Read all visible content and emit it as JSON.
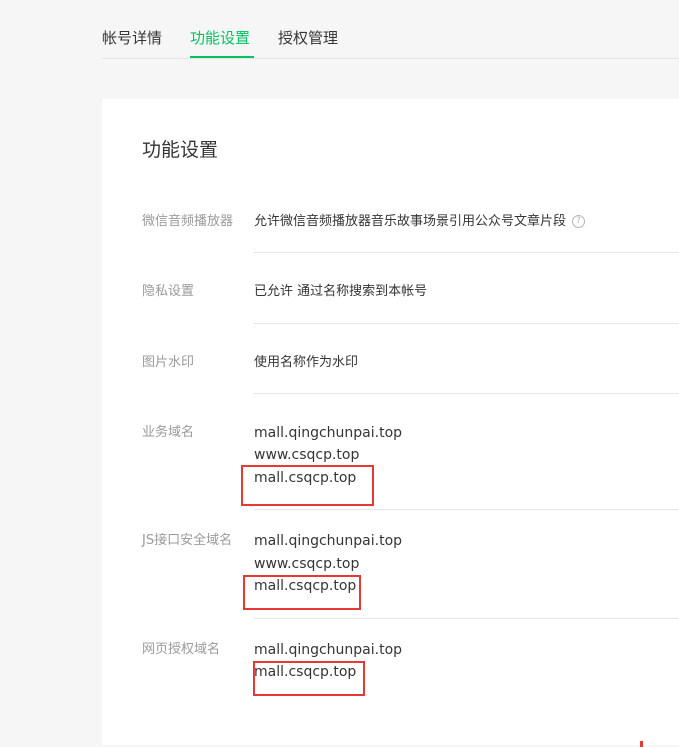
{
  "tabs": [
    {
      "label": "帐号详情",
      "active": false
    },
    {
      "label": "功能设置",
      "active": true
    },
    {
      "label": "授权管理",
      "active": false
    }
  ],
  "card_title": "功能设置",
  "rows": {
    "audio": {
      "label": "微信音频播放器",
      "value": "允许微信音频播放器音乐故事场景引用公众号文章片段",
      "help_icon": "question-circle-icon"
    },
    "privacy": {
      "label": "隐私设置",
      "value": "已允许 通过名称搜索到本帐号"
    },
    "watermark": {
      "label": "图片水印",
      "value": "使用名称作为水印"
    },
    "business_domain": {
      "label": "业务域名",
      "domains": [
        "mall.qingchunpai.top",
        "www.csqcp.top",
        "mall.csqcp.top"
      ]
    },
    "js_domain": {
      "label": "JS接口安全域名",
      "domains": [
        "mall.qingchunpai.top",
        "www.csqcp.top",
        "mall.csqcp.top"
      ]
    },
    "web_auth_domain": {
      "label": "网页授权域名",
      "domains": [
        "mall.qingchunpai.top",
        "mall.csqcp.top"
      ]
    }
  },
  "colors": {
    "accent": "#07c160",
    "highlight": "#e53935"
  }
}
